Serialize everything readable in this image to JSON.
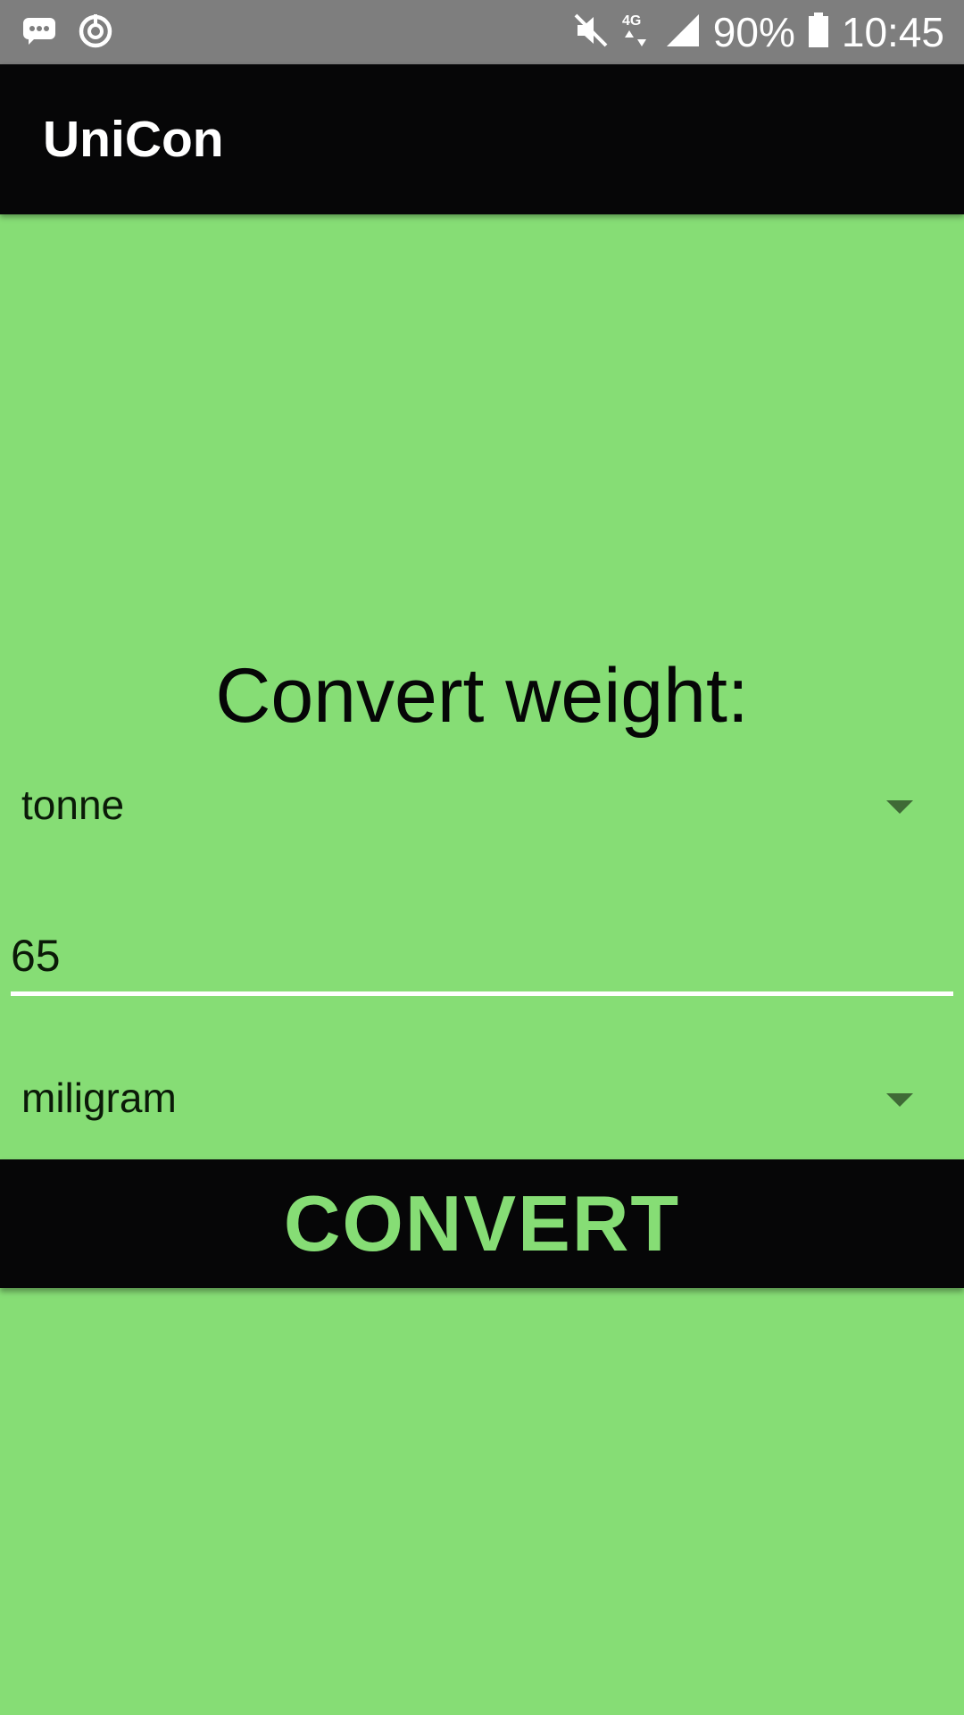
{
  "status_bar": {
    "battery_percent": "90%",
    "time": "10:45",
    "network_label": "4G",
    "icons": [
      "message-icon",
      "sync-icon",
      "mute-icon",
      "network-4g-icon",
      "signal-icon",
      "battery-icon"
    ]
  },
  "app_bar": {
    "title": "UniCon"
  },
  "main": {
    "heading": "Convert weight:",
    "from_unit": "tonne",
    "input_value": "65",
    "to_unit": "miligram",
    "convert_label": "CONVERT"
  },
  "colors": {
    "background": "#86DD75",
    "app_bar": "#060607",
    "status_bar": "#7E7E7E",
    "button_text": "#86DD75",
    "input_underline": "#FFFFFF"
  }
}
